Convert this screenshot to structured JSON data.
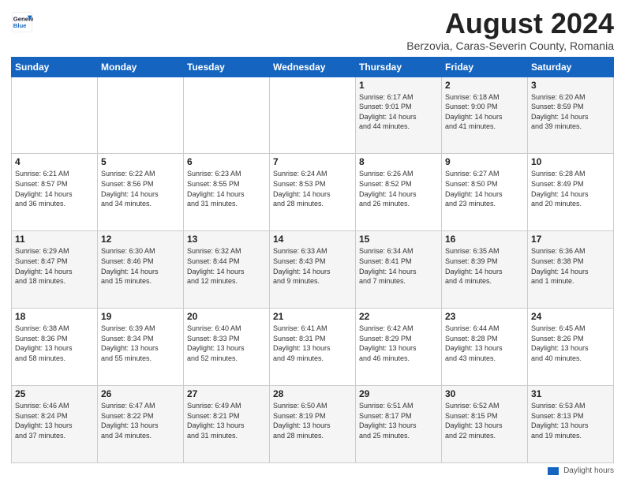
{
  "logo": {
    "line1": "General",
    "line2": "Blue"
  },
  "header": {
    "title": "August 2024",
    "subtitle": "Berzovia, Caras-Severin County, Romania"
  },
  "weekdays": [
    "Sunday",
    "Monday",
    "Tuesday",
    "Wednesday",
    "Thursday",
    "Friday",
    "Saturday"
  ],
  "footer": {
    "legend": "Daylight hours"
  },
  "weeks": [
    {
      "days": [
        {
          "num": "",
          "info": ""
        },
        {
          "num": "",
          "info": ""
        },
        {
          "num": "",
          "info": ""
        },
        {
          "num": "",
          "info": ""
        },
        {
          "num": "1",
          "info": "Sunrise: 6:17 AM\nSunset: 9:01 PM\nDaylight: 14 hours\nand 44 minutes."
        },
        {
          "num": "2",
          "info": "Sunrise: 6:18 AM\nSunset: 9:00 PM\nDaylight: 14 hours\nand 41 minutes."
        },
        {
          "num": "3",
          "info": "Sunrise: 6:20 AM\nSunset: 8:59 PM\nDaylight: 14 hours\nand 39 minutes."
        }
      ]
    },
    {
      "days": [
        {
          "num": "4",
          "info": "Sunrise: 6:21 AM\nSunset: 8:57 PM\nDaylight: 14 hours\nand 36 minutes."
        },
        {
          "num": "5",
          "info": "Sunrise: 6:22 AM\nSunset: 8:56 PM\nDaylight: 14 hours\nand 34 minutes."
        },
        {
          "num": "6",
          "info": "Sunrise: 6:23 AM\nSunset: 8:55 PM\nDaylight: 14 hours\nand 31 minutes."
        },
        {
          "num": "7",
          "info": "Sunrise: 6:24 AM\nSunset: 8:53 PM\nDaylight: 14 hours\nand 28 minutes."
        },
        {
          "num": "8",
          "info": "Sunrise: 6:26 AM\nSunset: 8:52 PM\nDaylight: 14 hours\nand 26 minutes."
        },
        {
          "num": "9",
          "info": "Sunrise: 6:27 AM\nSunset: 8:50 PM\nDaylight: 14 hours\nand 23 minutes."
        },
        {
          "num": "10",
          "info": "Sunrise: 6:28 AM\nSunset: 8:49 PM\nDaylight: 14 hours\nand 20 minutes."
        }
      ]
    },
    {
      "days": [
        {
          "num": "11",
          "info": "Sunrise: 6:29 AM\nSunset: 8:47 PM\nDaylight: 14 hours\nand 18 minutes."
        },
        {
          "num": "12",
          "info": "Sunrise: 6:30 AM\nSunset: 8:46 PM\nDaylight: 14 hours\nand 15 minutes."
        },
        {
          "num": "13",
          "info": "Sunrise: 6:32 AM\nSunset: 8:44 PM\nDaylight: 14 hours\nand 12 minutes."
        },
        {
          "num": "14",
          "info": "Sunrise: 6:33 AM\nSunset: 8:43 PM\nDaylight: 14 hours\nand 9 minutes."
        },
        {
          "num": "15",
          "info": "Sunrise: 6:34 AM\nSunset: 8:41 PM\nDaylight: 14 hours\nand 7 minutes."
        },
        {
          "num": "16",
          "info": "Sunrise: 6:35 AM\nSunset: 8:39 PM\nDaylight: 14 hours\nand 4 minutes."
        },
        {
          "num": "17",
          "info": "Sunrise: 6:36 AM\nSunset: 8:38 PM\nDaylight: 14 hours\nand 1 minute."
        }
      ]
    },
    {
      "days": [
        {
          "num": "18",
          "info": "Sunrise: 6:38 AM\nSunset: 8:36 PM\nDaylight: 13 hours\nand 58 minutes."
        },
        {
          "num": "19",
          "info": "Sunrise: 6:39 AM\nSunset: 8:34 PM\nDaylight: 13 hours\nand 55 minutes."
        },
        {
          "num": "20",
          "info": "Sunrise: 6:40 AM\nSunset: 8:33 PM\nDaylight: 13 hours\nand 52 minutes."
        },
        {
          "num": "21",
          "info": "Sunrise: 6:41 AM\nSunset: 8:31 PM\nDaylight: 13 hours\nand 49 minutes."
        },
        {
          "num": "22",
          "info": "Sunrise: 6:42 AM\nSunset: 8:29 PM\nDaylight: 13 hours\nand 46 minutes."
        },
        {
          "num": "23",
          "info": "Sunrise: 6:44 AM\nSunset: 8:28 PM\nDaylight: 13 hours\nand 43 minutes."
        },
        {
          "num": "24",
          "info": "Sunrise: 6:45 AM\nSunset: 8:26 PM\nDaylight: 13 hours\nand 40 minutes."
        }
      ]
    },
    {
      "days": [
        {
          "num": "25",
          "info": "Sunrise: 6:46 AM\nSunset: 8:24 PM\nDaylight: 13 hours\nand 37 minutes."
        },
        {
          "num": "26",
          "info": "Sunrise: 6:47 AM\nSunset: 8:22 PM\nDaylight: 13 hours\nand 34 minutes."
        },
        {
          "num": "27",
          "info": "Sunrise: 6:49 AM\nSunset: 8:21 PM\nDaylight: 13 hours\nand 31 minutes."
        },
        {
          "num": "28",
          "info": "Sunrise: 6:50 AM\nSunset: 8:19 PM\nDaylight: 13 hours\nand 28 minutes."
        },
        {
          "num": "29",
          "info": "Sunrise: 6:51 AM\nSunset: 8:17 PM\nDaylight: 13 hours\nand 25 minutes."
        },
        {
          "num": "30",
          "info": "Sunrise: 6:52 AM\nSunset: 8:15 PM\nDaylight: 13 hours\nand 22 minutes."
        },
        {
          "num": "31",
          "info": "Sunrise: 6:53 AM\nSunset: 8:13 PM\nDaylight: 13 hours\nand 19 minutes."
        }
      ]
    }
  ]
}
